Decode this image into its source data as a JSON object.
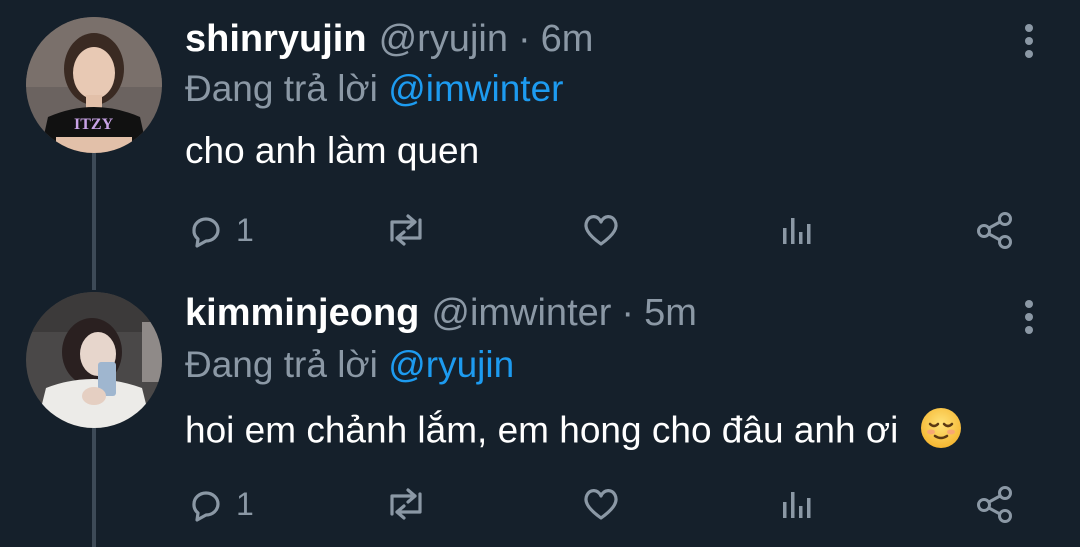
{
  "tweets": [
    {
      "name": "shinryujin",
      "handle": "@ryujin",
      "separator": "·",
      "time": "6m",
      "reply_prefix": "Đang trả lời",
      "reply_to": "@imwinter",
      "text": "cho anh làm quen",
      "reply_count": "1",
      "avatar_text": "ITZY"
    },
    {
      "name": "kimminjeong",
      "handle": "@imwinter",
      "separator": "·",
      "time": "5m",
      "reply_prefix": "Đang trả lời",
      "reply_to": "@ryujin",
      "text": "hoi em chảnh lắm, em hong cho đâu anh ơi",
      "reply_count": "1"
    }
  ],
  "colors": {
    "background": "#15202b",
    "muted": "#8b98a5",
    "mention": "#1d9bf0",
    "thread_line": "#3d4a57"
  },
  "icons": [
    "reply-icon",
    "retweet-icon",
    "like-icon",
    "analytics-icon",
    "share-icon",
    "more-icon",
    "relieved-face-emoji"
  ]
}
